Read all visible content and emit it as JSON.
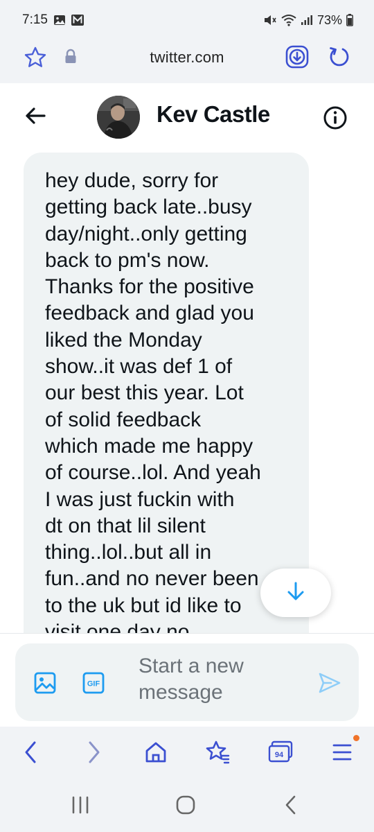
{
  "status_bar": {
    "time": "7:15",
    "battery": "73%",
    "icons": [
      "gallery-icon",
      "m-notification-icon",
      "mute-icon",
      "wifi-icon",
      "signal-icon",
      "battery-icon"
    ]
  },
  "browser": {
    "url": "twitter.com",
    "icons": [
      "star-icon",
      "lock-icon",
      "download-icon",
      "reload-icon"
    ]
  },
  "conversation": {
    "name": "Kev Castle",
    "icons": [
      "back-arrow-icon",
      "info-icon"
    ]
  },
  "message": {
    "text": "hey dude, sorry for\ngetting back late..busy\nday/night..only getting\nback to pm's now.\nThanks for the positive\nfeedback and glad you\nliked the Monday\nshow..it was def 1 of\nour best this year. Lot\nof solid feedback\nwhich made me happy\nof course..lol. And yeah\nI was just fuckin with\ndt on that lil silent\nthing..lol..but all in\nfun..and no never been\nto the uk but id like to\nvisit one day no"
  },
  "composer": {
    "placeholder": "Start a new message",
    "gif_label": "GIF",
    "icons": [
      "image-icon",
      "gif-icon",
      "send-icon"
    ]
  },
  "browser_nav": {
    "tab_count": "94",
    "icons": [
      "back-icon",
      "forward-icon",
      "home-icon",
      "bookmark-star-icon",
      "tabs-icon",
      "menu-icon"
    ]
  },
  "android_nav": {
    "icons": [
      "recents-icon",
      "home-circle-icon",
      "system-back-icon"
    ]
  },
  "colors": {
    "accent": "#3b4fd1",
    "twitter_blue": "#1d9bf0",
    "bubble": "#eff3f4",
    "chrome_bg": "#f1f3f6",
    "notification": "#f0732a"
  }
}
